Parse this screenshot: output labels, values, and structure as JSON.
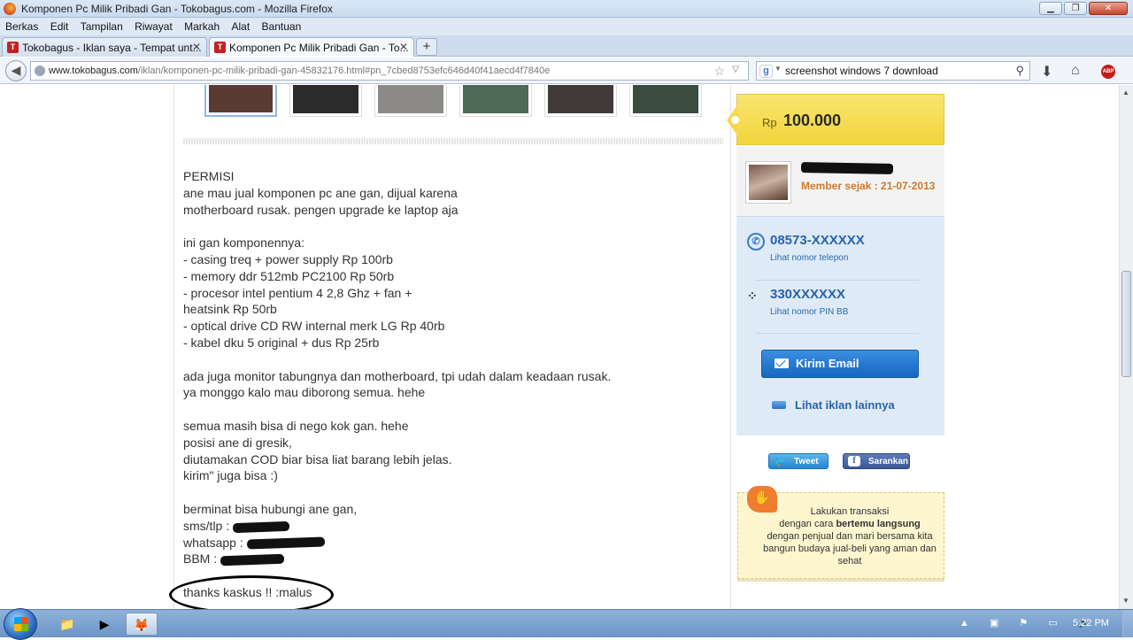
{
  "window": {
    "title": "Komponen Pc Milik Pribadi Gan - Tokobagus.com - Mozilla Firefox",
    "controls": [
      "▁",
      "❐",
      "✕"
    ]
  },
  "menu": [
    "Berkas",
    "Edit",
    "Tampilan",
    "Riwayat",
    "Markah",
    "Alat",
    "Bantuan"
  ],
  "tabs": [
    {
      "label": "Tokobagus - Iklan saya - Tempat unt...",
      "active": false
    },
    {
      "label": "Komponen Pc Milik Pribadi Gan - To...",
      "active": true
    }
  ],
  "newtab_label": "+",
  "nav": {
    "url_host": "www.tokobagus.com",
    "url_path": "/iklan/komponen-pc-milik-pribadi-gan-45832176.html#pn_7cbed8753efc646d40f41aecd4f7840e",
    "search_value": "screenshot windows 7 download",
    "search_engine_letter": "g",
    "abp_label": "ABP"
  },
  "thumbnails": [
    {
      "color": "#5a3b34",
      "selected": true
    },
    {
      "color": "#2b2b2b",
      "selected": false
    },
    {
      "color": "#8c8a87",
      "selected": false
    },
    {
      "color": "#4d6a56",
      "selected": false
    },
    {
      "color": "#403a38",
      "selected": false
    },
    {
      "color": "#3b4b3f",
      "selected": false
    }
  ],
  "description": {
    "greeting": "PERMISI",
    "intro": "ane mau jual komponen pc ane gan, dijual karena\nmotherboard rusak. pengen upgrade ke laptop aja",
    "list_header": "ini gan komponennya:",
    "items": "- casing treq + power supply Rp 100rb\n- memory ddr 512mb PC2100 Rp 50rb\n- procesor intel pentium 4 2,8 Ghz + fan +\nheatsink Rp 50rb\n- optical drive CD RW internal merk LG Rp 40rb\n- kabel dku 5 original + dus Rp 25rb",
    "extra": "ada juga monitor tabungnya dan motherboard, tpi udah dalam keadaan rusak.\nya monggo kalo mau diborong semua. hehe",
    "nego": "semua masih bisa di nego kok gan. hehe\nposisi ane di gresik,\ndiutamakan COD biar bisa liat barang lebih jelas.\nkirim\" juga bisa :)",
    "contact_intro": "berminat bisa hubungi ane gan,",
    "sms_label": "sms/tlp : ",
    "wa_label": "whatsapp : ",
    "bbm_label": "BBM : ",
    "thanks": "thanks kaskus !! :malus"
  },
  "price": {
    "currency": "Rp",
    "amount": "100.000"
  },
  "seller": {
    "since": "Member sejak : 21-07-2013"
  },
  "contact": {
    "phone": "08573-XXXXXX",
    "phone_link": "Lihat nomor telepon",
    "pin": "330XXXXXX",
    "pin_link": "Lihat nomor PIN BB",
    "email_button": "Kirim Email",
    "more_ads": "Lihat iklan lainnya"
  },
  "social": {
    "tweet": "Tweet",
    "share": "Sarankan"
  },
  "safety": {
    "line1": "Lakukan transaksi",
    "line2_pre": "dengan cara ",
    "line2_bold": "bertemu langsung",
    "rest": "dengan penjual dan mari bersama kita bangun budaya jual-beli yang aman dan sehat"
  },
  "taskbar": {
    "clock": "5:22 PM"
  },
  "colors": {
    "link_blue": "#2864a8",
    "price_yellow": "#f4d94c",
    "since_orange": "#d07a2a"
  }
}
